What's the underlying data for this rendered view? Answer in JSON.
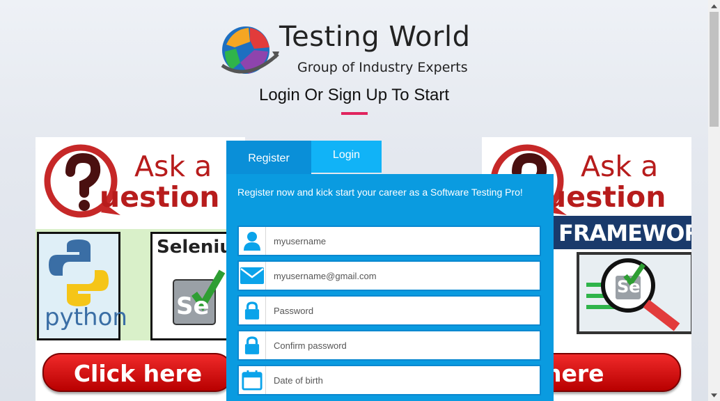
{
  "brand": {
    "title": "Testing World",
    "subtitle": "Group of Industry Experts"
  },
  "page": {
    "heading": "Login Or Sign Up To Start",
    "accent_color": "#e0245e"
  },
  "tabs": [
    {
      "label": "Register",
      "active": true
    },
    {
      "label": "Login",
      "active": false
    }
  ],
  "form": {
    "message": "Register now and kick start your career as a Software Testing Pro!",
    "fields": [
      {
        "placeholder": "myusername",
        "icon": "user-icon"
      },
      {
        "placeholder": "myusername@gmail.com",
        "icon": "envelope-icon"
      },
      {
        "placeholder": "Password",
        "icon": "lock-icon"
      },
      {
        "placeholder": "Confirm password",
        "icon": "lock-icon"
      },
      {
        "placeholder": "Date of birth",
        "icon": "calendar-icon"
      }
    ],
    "panel_color": "#0a9be0",
    "icon_color": "#0aa3ea"
  },
  "left_banner": {
    "ask_line1": "Ask a",
    "ask_line2": "uestion",
    "python": "python",
    "selenium": "Selenium",
    "selenium_logo": "Se",
    "cta": "Click here"
  },
  "right_banner": {
    "ask_line1": "Ask a",
    "ask_line2": "uestion",
    "framework": "FRAMEWORK",
    "selenium_logo": "Se",
    "cta": "ck here"
  }
}
